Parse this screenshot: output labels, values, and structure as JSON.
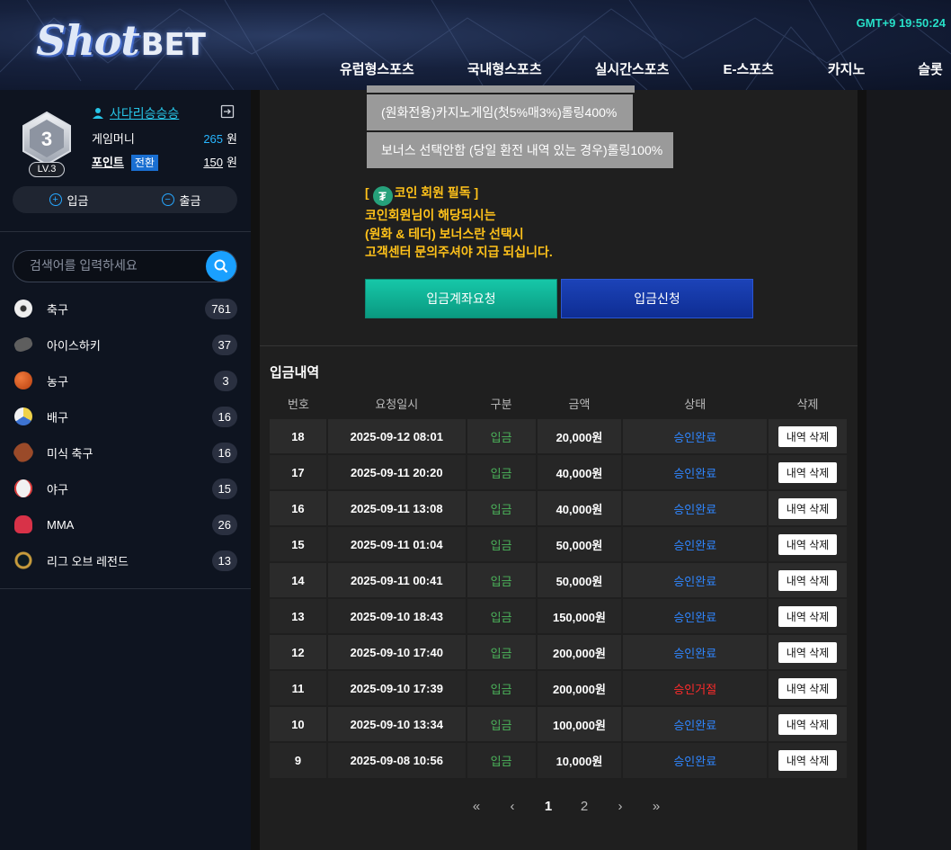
{
  "header": {
    "logo_shot": "Shot",
    "logo_bet": "BET",
    "clock": "GMT+9 19:50:24",
    "nav": [
      "유럽형스포츠",
      "국내형스포츠",
      "실시간스포츠",
      "E-스포츠",
      "카지노",
      "슬롯"
    ]
  },
  "sidebar": {
    "level_number": "3",
    "level_tag": "LV.3",
    "username": "사다리승승승",
    "game_money_label": "게임머니",
    "game_money_value": "265",
    "game_money_unit": "원",
    "point_label": "포인트",
    "convert_label": "전환",
    "point_value": "150",
    "point_unit": "원",
    "deposit_label": "입금",
    "withdraw_label": "출금",
    "search_placeholder": "검색어를 입력하세요",
    "sports": [
      {
        "name": "축구",
        "count": "761",
        "icon": "soccer-ball-icon",
        "color": "#e8e8e8"
      },
      {
        "name": "아이스하키",
        "count": "37",
        "icon": "hockey-puck-icon",
        "color": "#6a6a6a"
      },
      {
        "name": "농구",
        "count": "3",
        "icon": "basketball-icon",
        "color": "#d9531e"
      },
      {
        "name": "배구",
        "count": "16",
        "icon": "volleyball-icon",
        "color": "#e7c94a"
      },
      {
        "name": "미식 축구",
        "count": "16",
        "icon": "american-football-icon",
        "color": "#a0512d"
      },
      {
        "name": "야구",
        "count": "15",
        "icon": "baseball-icon",
        "color": "#f2f2f2"
      },
      {
        "name": "MMA",
        "count": "26",
        "icon": "boxing-glove-icon",
        "color": "#d83248"
      },
      {
        "name": "리그 오브 레전드",
        "count": "13",
        "icon": "league-of-legends-icon",
        "color": "#c89b3c"
      }
    ]
  },
  "main": {
    "rule_1": "(원화전용)카지노게임(첫5%매3%)롤링400%",
    "rule_2": "보너스 선택안함 (당일 환전 내역 있는 경우)롤링100%",
    "coin_title": "코인 회원 필독 ]",
    "coin_open": "[",
    "coin_line_1": "코인회원님이 해당되시는",
    "coin_line_2": "(원화 & 테더) 보너스란 선택시",
    "coin_line_3": "고객센터 문의주셔야 지급 되십니다.",
    "btn_account_request": "입금계좌요청",
    "btn_deposit_apply": "입금신청",
    "history_title": "입금내역",
    "columns": [
      "번호",
      "요청일시",
      "구분",
      "금액",
      "상태",
      "삭제"
    ],
    "rows": [
      {
        "no": "18",
        "date": "2025-09-12 08:01",
        "type": "입금",
        "amount": "20,000원",
        "status": "승인완료",
        "del": "내역 삭제"
      },
      {
        "no": "17",
        "date": "2025-09-11 20:20",
        "type": "입금",
        "amount": "40,000원",
        "status": "승인완료",
        "del": "내역 삭제"
      },
      {
        "no": "16",
        "date": "2025-09-11 13:08",
        "type": "입금",
        "amount": "40,000원",
        "status": "승인완료",
        "del": "내역 삭제"
      },
      {
        "no": "15",
        "date": "2025-09-11 01:04",
        "type": "입금",
        "amount": "50,000원",
        "status": "승인완료",
        "del": "내역 삭제"
      },
      {
        "no": "14",
        "date": "2025-09-11 00:41",
        "type": "입금",
        "amount": "50,000원",
        "status": "승인완료",
        "del": "내역 삭제"
      },
      {
        "no": "13",
        "date": "2025-09-10 18:43",
        "type": "입금",
        "amount": "150,000원",
        "status": "승인완료",
        "del": "내역 삭제"
      },
      {
        "no": "12",
        "date": "2025-09-10 17:40",
        "type": "입금",
        "amount": "200,000원",
        "status": "승인완료",
        "del": "내역 삭제"
      },
      {
        "no": "11",
        "date": "2025-09-10 17:39",
        "type": "입금",
        "amount": "200,000원",
        "status": "승인거절",
        "del": "내역 삭제"
      },
      {
        "no": "10",
        "date": "2025-09-10 13:34",
        "type": "입금",
        "amount": "100,000원",
        "status": "승인완료",
        "del": "내역 삭제"
      },
      {
        "no": "9",
        "date": "2025-09-08 10:56",
        "type": "입금",
        "amount": "10,000원",
        "status": "승인완료",
        "del": "내역 삭제"
      }
    ],
    "pager": {
      "first": "«",
      "prev": "‹",
      "pages": [
        "1",
        "2"
      ],
      "next": "›",
      "last": "»",
      "current": "1"
    }
  }
}
